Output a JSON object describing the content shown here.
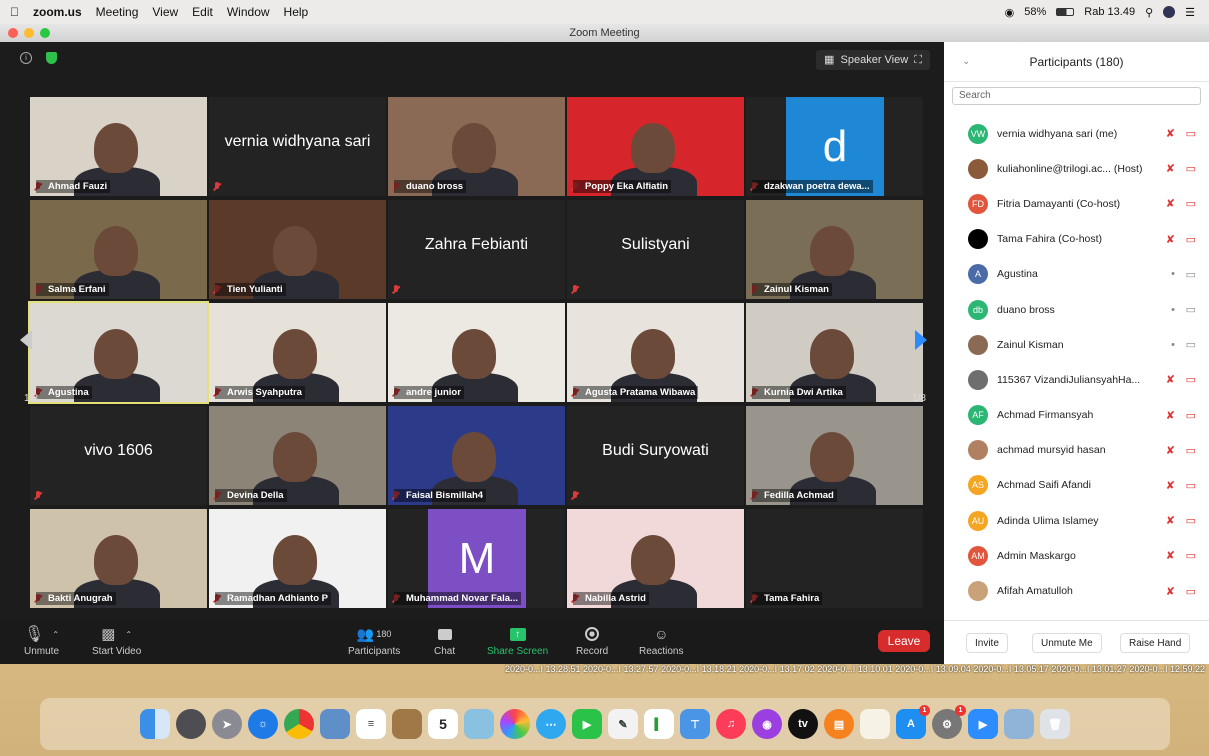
{
  "menubar": {
    "app": "zoom.us",
    "items": [
      "Meeting",
      "View",
      "Edit",
      "Window",
      "Help"
    ],
    "battery": "58%",
    "clock": "Rab 13.49"
  },
  "window": {
    "title": "Zoom Meeting"
  },
  "video": {
    "speaker_view": "Speaker View",
    "page_left": "1/8",
    "page_right": "1/8",
    "tiles": [
      {
        "name": "Ahmad Fauzi",
        "kind": "photo",
        "bg": "#d9d2c6"
      },
      {
        "name": "",
        "kind": "text",
        "big": "vernia widhyana sari"
      },
      {
        "name": "duano bross",
        "kind": "photo",
        "bg": "#8a6a55"
      },
      {
        "name": "Poppy Eka Alfiatin",
        "kind": "photo",
        "bg": "#d6262b"
      },
      {
        "name": "dzakwan poetra dewa...",
        "kind": "letter",
        "big": "d",
        "bg": "#1e88d6"
      },
      {
        "name": "Salma Erfani",
        "kind": "photo",
        "bg": "#7a6a4b"
      },
      {
        "name": "Tien Yulianti",
        "kind": "photo",
        "bg": "#5b3a2a"
      },
      {
        "name": "",
        "kind": "text",
        "big": "Zahra Febianti"
      },
      {
        "name": "",
        "kind": "text",
        "big": "Sulistyani"
      },
      {
        "name": "Zainul Kisman",
        "kind": "photo",
        "bg": "#7a6f56"
      },
      {
        "name": "Agustina",
        "kind": "photo",
        "bg": "#dcd8d2"
      },
      {
        "name": "Arwis Syahputra",
        "kind": "photo",
        "bg": "#e6e2da"
      },
      {
        "name": "andre junior",
        "kind": "photo",
        "bg": "#ece9e2"
      },
      {
        "name": "Agusta Pratama Wibawa",
        "kind": "photo",
        "bg": "#e8e4dd"
      },
      {
        "name": "Kurnia Dwi Artika",
        "kind": "photo",
        "bg": "#d0ccc4"
      },
      {
        "name": "",
        "kind": "text",
        "big": "vivo 1606"
      },
      {
        "name": "Devina Della",
        "kind": "photo",
        "bg": "#8c8477"
      },
      {
        "name": "Faisal Bismillah4",
        "kind": "photo",
        "bg": "#2c3a8a"
      },
      {
        "name": "",
        "kind": "text",
        "big": "Budi Suryowati"
      },
      {
        "name": "Fedilla Achmad",
        "kind": "photo",
        "bg": "#9a958c"
      },
      {
        "name": "Bakti Anugrah",
        "kind": "photo",
        "bg": "#cfc2ab"
      },
      {
        "name": "Ramadhan Adhianto P",
        "kind": "photo",
        "bg": "#f1f1f1"
      },
      {
        "name": "Muhammad Novar Fala...",
        "kind": "letter",
        "big": "M",
        "bg": "#7c4fc4"
      },
      {
        "name": "Nabilla Astrid",
        "kind": "photo",
        "bg": "#f2d9d9"
      },
      {
        "name": "Tama Fahira",
        "kind": "photo",
        "bg": "#232323"
      }
    ]
  },
  "toolbar": {
    "unmute": "Unmute",
    "start_video": "Start Video",
    "participants": "Participants",
    "participants_count": "180",
    "chat": "Chat",
    "share_screen": "Share Screen",
    "record": "Record",
    "reactions": "Reactions",
    "leave": "Leave"
  },
  "panel": {
    "title": "Participants (180)",
    "search_placeholder": "Search",
    "invite": "Invite",
    "unmute_me": "Unmute Me",
    "raise_hand": "Raise Hand",
    "participants": [
      {
        "name": "vernia widhyana sari (me)",
        "initials": "VW",
        "color": "#2bb673",
        "muted": true
      },
      {
        "name": "kuliahonline@trilogi.ac... (Host)",
        "initials": "",
        "color": "#8a5a3b",
        "muted": true
      },
      {
        "name": "Fitria Damayanti (Co-host)",
        "initials": "FD",
        "color": "#e0553c",
        "muted": true
      },
      {
        "name": "Tama Fahira (Co-host)",
        "initials": "",
        "color": "#000000",
        "muted": true
      },
      {
        "name": "Agustina",
        "initials": "A",
        "color": "#4a6aa8",
        "muted": false
      },
      {
        "name": "duano bross",
        "initials": "db",
        "color": "#2bb673",
        "muted": false
      },
      {
        "name": "Zainul Kisman",
        "initials": "",
        "color": "#8a6a55",
        "muted": false
      },
      {
        "name": "115367 VizandiJuliansyahHa...",
        "initials": "",
        "color": "#6e6e6e",
        "muted": true
      },
      {
        "name": "Achmad Firmansyah",
        "initials": "AF",
        "color": "#2bb673",
        "muted": true
      },
      {
        "name": "achmad mursyid hasan",
        "initials": "",
        "color": "#b08060",
        "muted": true
      },
      {
        "name": "Achmad Saifi Afandi",
        "initials": "AS",
        "color": "#f4a623",
        "muted": true
      },
      {
        "name": "Adinda Ulima Islamey",
        "initials": "AU",
        "color": "#f4a623",
        "muted": true
      },
      {
        "name": "Admin Maskargo",
        "initials": "AM",
        "color": "#e0553c",
        "muted": true
      },
      {
        "name": "Afifah Amatulloh",
        "initials": "",
        "color": "#c9a27a",
        "muted": true
      }
    ]
  },
  "timestamps": "2020-0...I 13.28.51  2020-0...I 13.27.57  2020-0...I 13.18.21  2020-0...I 13.17.02  2020-0...I 13.10.01  2020-0...I 13.09.04  2020-0...I 13.05.17  2020-0...I 13.01.27  2020-0...I 12.59.22",
  "dock": {
    "calendar_day": "5",
    "badges": [
      "1",
      "1"
    ]
  }
}
